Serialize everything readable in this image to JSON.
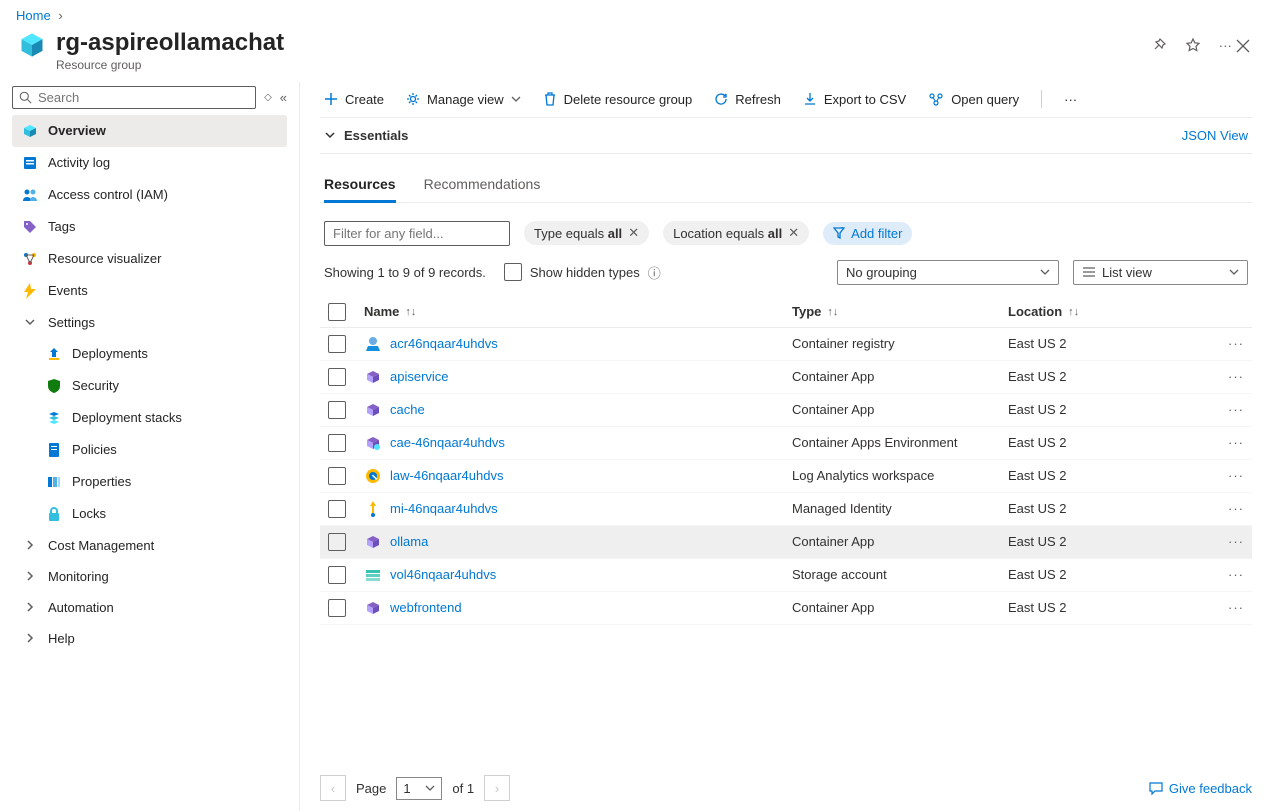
{
  "breadcrumb": {
    "home": "Home"
  },
  "header": {
    "title": "rg-aspireollamachat",
    "subtitle": "Resource group"
  },
  "sidebar": {
    "search_placeholder": "Search",
    "items": [
      {
        "label": "Overview"
      },
      {
        "label": "Activity log"
      },
      {
        "label": "Access control (IAM)"
      },
      {
        "label": "Tags"
      },
      {
        "label": "Resource visualizer"
      },
      {
        "label": "Events"
      }
    ],
    "settings": {
      "label": "Settings",
      "items": [
        {
          "label": "Deployments"
        },
        {
          "label": "Security"
        },
        {
          "label": "Deployment stacks"
        },
        {
          "label": "Policies"
        },
        {
          "label": "Properties"
        },
        {
          "label": "Locks"
        }
      ]
    },
    "collapsed": [
      {
        "label": "Cost Management"
      },
      {
        "label": "Monitoring"
      },
      {
        "label": "Automation"
      },
      {
        "label": "Help"
      }
    ]
  },
  "toolbar": {
    "create": "Create",
    "manage_view": "Manage view",
    "delete": "Delete resource group",
    "refresh": "Refresh",
    "export": "Export to CSV",
    "open_query": "Open query"
  },
  "essentials": {
    "label": "Essentials",
    "json_view": "JSON View"
  },
  "tabs": {
    "resources": "Resources",
    "recommendations": "Recommendations"
  },
  "filters": {
    "placeholder": "Filter for any field...",
    "type_prefix": "Type equals ",
    "type_value": "all",
    "location_prefix": "Location equals ",
    "location_value": "all",
    "add": "Add filter"
  },
  "status": {
    "showing": "Showing 1 to 9 of 9 records.",
    "show_hidden": "Show hidden types",
    "grouping": "No grouping",
    "view": "List view"
  },
  "columns": {
    "name": "Name",
    "type": "Type",
    "location": "Location"
  },
  "resources": [
    {
      "name": "acr46nqaar4uhdvs",
      "type": "Container registry",
      "location": "East US 2",
      "icon": "acr"
    },
    {
      "name": "apiservice",
      "type": "Container App",
      "location": "East US 2",
      "icon": "capp"
    },
    {
      "name": "cache",
      "type": "Container App",
      "location": "East US 2",
      "icon": "capp"
    },
    {
      "name": "cae-46nqaar4uhdvs",
      "type": "Container Apps Environment",
      "location": "East US 2",
      "icon": "cae"
    },
    {
      "name": "law-46nqaar4uhdvs",
      "type": "Log Analytics workspace",
      "location": "East US 2",
      "icon": "law"
    },
    {
      "name": "mi-46nqaar4uhdvs",
      "type": "Managed Identity",
      "location": "East US 2",
      "icon": "mi"
    },
    {
      "name": "ollama",
      "type": "Container App",
      "location": "East US 2",
      "icon": "capp",
      "hover": true
    },
    {
      "name": "vol46nqaar4uhdvs",
      "type": "Storage account",
      "location": "East US 2",
      "icon": "storage"
    },
    {
      "name": "webfrontend",
      "type": "Container App",
      "location": "East US 2",
      "icon": "capp"
    }
  ],
  "pager": {
    "page_label": "Page",
    "page": "1",
    "of": "of 1"
  },
  "feedback": "Give feedback"
}
